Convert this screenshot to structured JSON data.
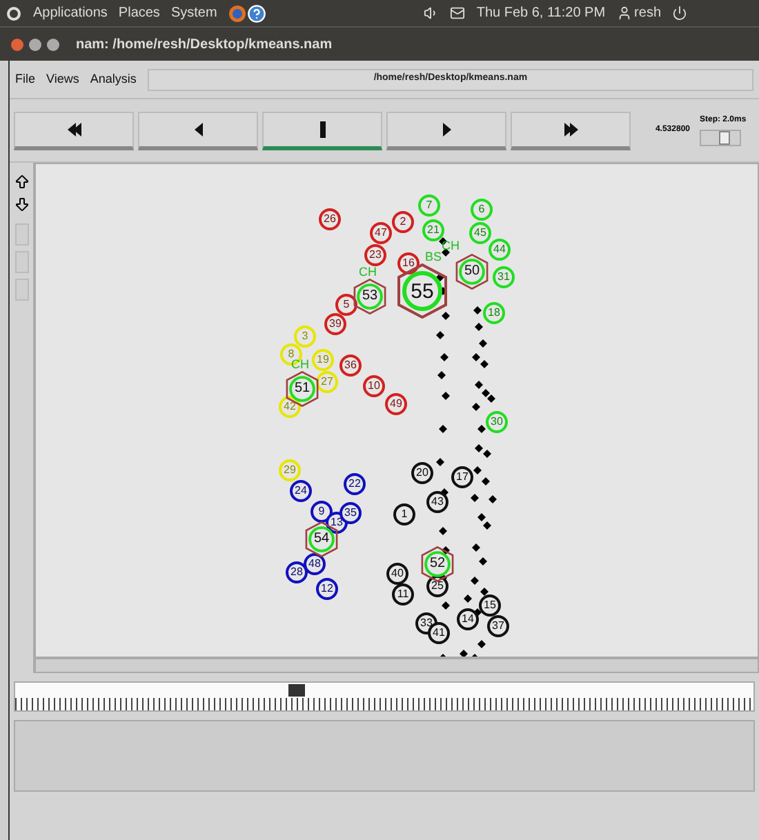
{
  "top_panel": {
    "menus": [
      "Applications",
      "Places",
      "System"
    ],
    "clock": "Thu Feb 6, 11:20 PM",
    "user": "resh"
  },
  "window": {
    "title": "nam: /home/resh/Desktop/kmeans.nam"
  },
  "menubar": {
    "menus": [
      "File",
      "Views",
      "Analysis"
    ],
    "file_path": "/home/resh/Desktop/kmeans.nam"
  },
  "controls": [
    {
      "kind": "rewind",
      "selected": false
    },
    {
      "kind": "back",
      "selected": false
    },
    {
      "kind": "stop",
      "selected": true
    },
    {
      "kind": "play",
      "selected": false
    },
    {
      "kind": "forward",
      "selected": false
    }
  ],
  "time": "4.532800",
  "step": {
    "label": "Step: 2.0ms",
    "level": 0.6
  },
  "nodes": [
    {
      "label": "26",
      "color": "#d42020",
      "kind": "node"
    },
    {
      "label": "2",
      "color": "#d42020",
      "kind": "node"
    },
    {
      "label": "47",
      "color": "#d42020",
      "kind": "node"
    },
    {
      "label": "23",
      "color": "#d42020",
      "kind": "node"
    },
    {
      "label": "16",
      "color": "#d42020",
      "kind": "node"
    },
    {
      "label": "5",
      "color": "#d42020",
      "kind": "node"
    },
    {
      "label": "39",
      "color": "#d42020",
      "kind": "node"
    },
    {
      "label": "36",
      "color": "#d42020",
      "kind": "node"
    },
    {
      "label": "10",
      "color": "#d42020",
      "kind": "node"
    },
    {
      "label": "49",
      "color": "#d42020",
      "kind": "node"
    },
    {
      "label": "7",
      "color": "#22dd22",
      "kind": "node"
    },
    {
      "label": "21",
      "color": "#22dd22",
      "kind": "node"
    },
    {
      "label": "6",
      "color": "#22dd22",
      "kind": "node"
    },
    {
      "label": "45",
      "color": "#22dd22",
      "kind": "node"
    },
    {
      "label": "44",
      "color": "#22dd22",
      "kind": "node"
    },
    {
      "label": "31",
      "color": "#22dd22",
      "kind": "node"
    },
    {
      "label": "18",
      "color": "#22dd22",
      "kind": "node"
    },
    {
      "label": "30",
      "color": "#22dd22",
      "kind": "node"
    },
    {
      "label": "3",
      "color": "#e6e600",
      "kind": "node"
    },
    {
      "label": "8",
      "color": "#e6e600",
      "kind": "node"
    },
    {
      "label": "19",
      "color": "#e6e600",
      "kind": "node"
    },
    {
      "label": "27",
      "color": "#e6e600",
      "kind": "node"
    },
    {
      "label": "42",
      "color": "#e6e600",
      "kind": "node"
    },
    {
      "label": "29",
      "color": "#e6e600",
      "kind": "node"
    },
    {
      "label": "24",
      "color": "#1010c0",
      "kind": "node"
    },
    {
      "label": "22",
      "color": "#1010c0",
      "kind": "node"
    },
    {
      "label": "9",
      "color": "#1010c0",
      "kind": "node"
    },
    {
      "label": "13",
      "color": "#1010c0",
      "kind": "node"
    },
    {
      "label": "35",
      "color": "#1010c0",
      "kind": "node"
    },
    {
      "label": "28",
      "color": "#1010c0",
      "kind": "node"
    },
    {
      "label": "48",
      "color": "#1010c0",
      "kind": "node"
    },
    {
      "label": "12",
      "color": "#1010c0",
      "kind": "node"
    },
    {
      "label": "20",
      "color": "#111111",
      "kind": "node"
    },
    {
      "label": "17",
      "color": "#111111",
      "kind": "node"
    },
    {
      "label": "43",
      "color": "#111111",
      "kind": "node"
    },
    {
      "label": "1",
      "color": "#111111",
      "kind": "node"
    },
    {
      "label": "40",
      "color": "#111111",
      "kind": "node"
    },
    {
      "label": "11",
      "color": "#111111",
      "kind": "node"
    },
    {
      "label": "25",
      "color": "#111111",
      "kind": "node"
    },
    {
      "label": "33",
      "color": "#111111",
      "kind": "node"
    },
    {
      "label": "41",
      "color": "#111111",
      "kind": "node"
    },
    {
      "label": "14",
      "color": "#111111",
      "kind": "node"
    },
    {
      "label": "15",
      "color": "#111111",
      "kind": "node"
    },
    {
      "label": "37",
      "color": "#111111",
      "kind": "node"
    },
    {
      "label": "53",
      "color": "#22dd22",
      "kind": "head",
      "caption": "CH"
    },
    {
      "label": "55",
      "color": "#22dd22",
      "kind": "head",
      "caption": "BS"
    },
    {
      "label": "50",
      "color": "#22dd22",
      "kind": "head",
      "caption": "CH"
    },
    {
      "label": "51",
      "color": "#22dd22",
      "kind": "head",
      "caption": "CH"
    },
    {
      "label": "54",
      "color": "#22dd22",
      "kind": "head"
    },
    {
      "label": "52",
      "color": "#22dd22",
      "kind": "head"
    }
  ],
  "timeline": {
    "level": 0.37
  }
}
